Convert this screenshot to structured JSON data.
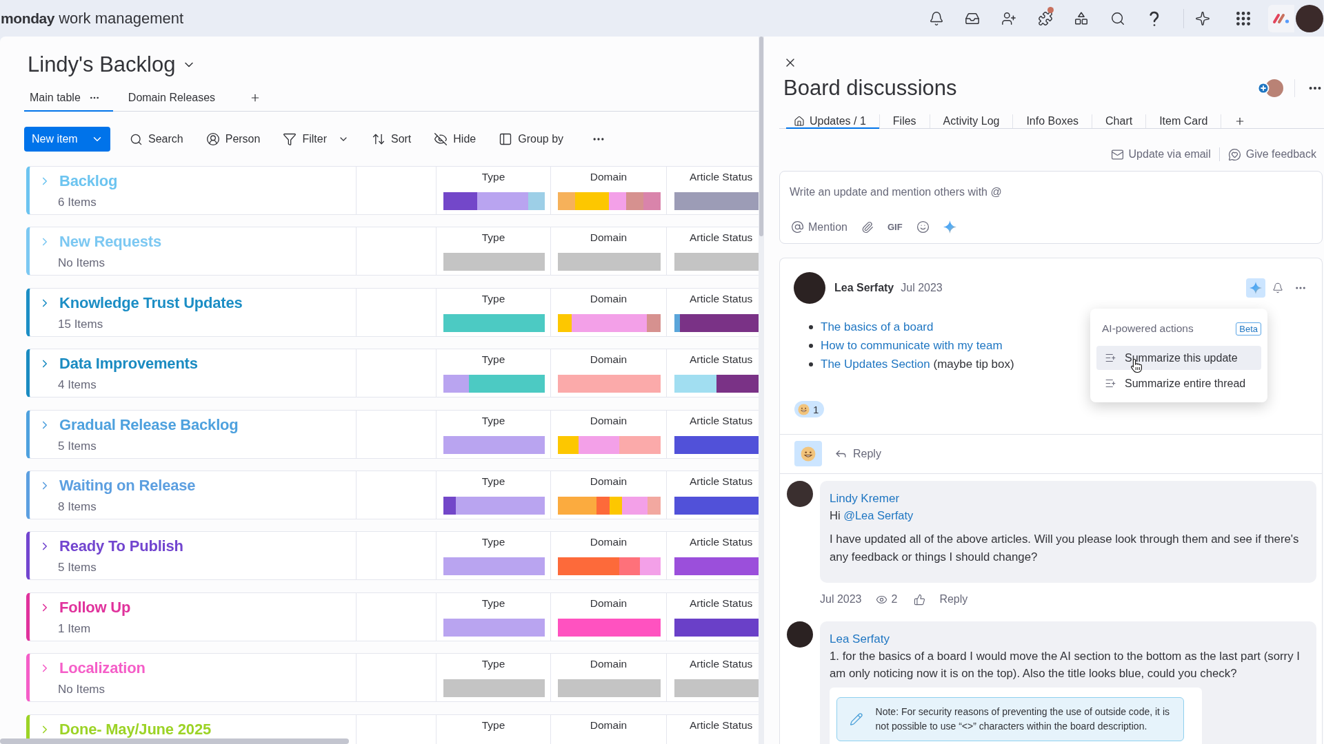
{
  "top_bar": {
    "brand": "monday",
    "product": "work management",
    "apps_notification": true
  },
  "board": {
    "title": "Lindy's Backlog",
    "views": [
      {
        "label": "Main table",
        "selected": true
      },
      {
        "label": "Domain Releases",
        "selected": false
      }
    ]
  },
  "toolbar": {
    "new_item": "New item",
    "actions": [
      {
        "kind": "search",
        "label": "Search",
        "dropdown": false
      },
      {
        "kind": "person",
        "label": "Person",
        "dropdown": false
      },
      {
        "kind": "filter",
        "label": "Filter",
        "dropdown": true
      },
      {
        "kind": "sort",
        "label": "Sort",
        "dropdown": false
      },
      {
        "kind": "hide",
        "label": "Hide",
        "dropdown": false
      },
      {
        "kind": "group",
        "label": "Group by",
        "dropdown": false
      }
    ]
  },
  "groups": [
    {
      "title": "Backlog",
      "count": "6 Items",
      "color": "#6cc4f0",
      "columns": [
        {
          "label": "Type",
          "items": [
            {
              "color": "#7347c9"
            },
            {
              "color": "#7347c9"
            },
            {
              "color": "#b9a4f0"
            },
            {
              "color": "#b9a4f0"
            },
            {
              "color": "#b9a4f0"
            },
            {
              "color": "#9dcfe7"
            }
          ]
        },
        {
          "label": "Domain",
          "items": [
            {
              "color": "#f6b15a"
            },
            {
              "color": "#fdc700"
            },
            {
              "color": "#fdc700"
            },
            {
              "color": "#f3a0e8"
            },
            {
              "color": "#d6918f"
            },
            {
              "color": "#d984ab"
            }
          ]
        },
        {
          "label": "Article Status",
          "items": [
            {
              "color": "#9c9cb6"
            },
            {
              "color": "#9c9cb6"
            },
            {
              "color": "#9c9cb6"
            },
            {
              "color": "#9c9cb6"
            },
            {
              "color": "#9c9cb6"
            },
            {
              "color": "#9c9cb6"
            }
          ]
        }
      ]
    },
    {
      "title": "New Requests",
      "count": "No Items",
      "color": "#7cc8f2",
      "columns": [
        {
          "label": "Type",
          "empty": true
        },
        {
          "label": "Domain",
          "empty": true
        },
        {
          "label": "Article Status",
          "empty": true
        }
      ]
    },
    {
      "title": "Knowledge Trust Updates",
      "count": "15 Items",
      "color": "#1c8ec5",
      "columns": [
        {
          "label": "Type",
          "items": [
            {
              "color": "#4ccac3"
            },
            {
              "color": "#4ccac3"
            },
            {
              "color": "#4ccac3"
            },
            {
              "color": "#4ccac3"
            },
            {
              "color": "#4ccac3"
            },
            {
              "color": "#4ccac3"
            },
            {
              "color": "#4ccac3"
            },
            {
              "color": "#4ccac3"
            },
            {
              "color": "#4ccac3"
            },
            {
              "color": "#4ccac3"
            },
            {
              "color": "#4ccac3"
            },
            {
              "color": "#4ccac3"
            },
            {
              "color": "#4ccac3"
            },
            {
              "color": "#4ccac3"
            },
            {
              "color": "#4ccac3"
            }
          ]
        },
        {
          "label": "Domain",
          "items": [
            {
              "color": "#fdc700"
            },
            {
              "color": "#fdc700"
            },
            {
              "color": "#f3a0e8"
            },
            {
              "color": "#f3a0e8"
            },
            {
              "color": "#f3a0e8"
            },
            {
              "color": "#f3a0e8"
            },
            {
              "color": "#f3a0e8"
            },
            {
              "color": "#f3a0e8"
            },
            {
              "color": "#f3a0e8"
            },
            {
              "color": "#f3a0e8"
            },
            {
              "color": "#f3a0e8"
            },
            {
              "color": "#f3a0e8"
            },
            {
              "color": "#f3a0e8"
            },
            {
              "color": "#d6918f"
            },
            {
              "color": "#d6918f"
            }
          ]
        },
        {
          "label": "Article Status",
          "items": [
            {
              "color": "#5aa5da"
            },
            {
              "color": "#7a3286"
            },
            {
              "color": "#7a3286"
            },
            {
              "color": "#7a3286"
            },
            {
              "color": "#7a3286"
            },
            {
              "color": "#7a3286"
            },
            {
              "color": "#7a3286"
            },
            {
              "color": "#7a3286"
            },
            {
              "color": "#7a3286"
            },
            {
              "color": "#7a3286"
            },
            {
              "color": "#7a3286"
            },
            {
              "color": "#7a3286"
            },
            {
              "color": "#7a3286"
            },
            {
              "color": "#7a3286"
            },
            {
              "color": "#7a3286"
            }
          ]
        }
      ]
    },
    {
      "title": "Data Improvements",
      "count": "4 Items",
      "color": "#1a8bc1",
      "columns": [
        {
          "label": "Type",
          "items": [
            {
              "color": "#b9a4f0"
            },
            {
              "color": "#4ccac3"
            },
            {
              "color": "#4ccac3"
            },
            {
              "color": "#4ccac3"
            }
          ]
        },
        {
          "label": "Domain",
          "items": [
            {
              "color": "#fbaaaa"
            },
            {
              "color": "#fbaaaa"
            },
            {
              "color": "#fbaaaa"
            },
            {
              "color": "#fbaaaa"
            }
          ]
        },
        {
          "label": "Article Status",
          "items": [
            {
              "color": "#a1def1"
            },
            {
              "color": "#a1def1"
            },
            {
              "color": "#7a3286"
            },
            {
              "color": "#7a3286"
            }
          ]
        }
      ]
    },
    {
      "title": "Gradual Release Backlog",
      "count": "5 Items",
      "color": "#4ea1de",
      "columns": [
        {
          "label": "Type",
          "items": [
            {
              "color": "#b9a4f0"
            },
            {
              "color": "#b9a4f0"
            },
            {
              "color": "#b9a4f0"
            },
            {
              "color": "#b9a4f0"
            },
            {
              "color": "#b9a4f0"
            }
          ]
        },
        {
          "label": "Domain",
          "items": [
            {
              "color": "#fdc700"
            },
            {
              "color": "#f3a0e8"
            },
            {
              "color": "#f3a0e8"
            },
            {
              "color": "#fbaaaa"
            },
            {
              "color": "#fbaaaa"
            }
          ]
        },
        {
          "label": "Article Status",
          "items": [
            {
              "color": "#5151d9"
            },
            {
              "color": "#5151d9"
            },
            {
              "color": "#5151d9"
            },
            {
              "color": "#5151d9"
            },
            {
              "color": "#5151d9"
            }
          ]
        }
      ]
    },
    {
      "title": "Waiting on Release",
      "count": "8 Items",
      "color": "#5c9fe0",
      "columns": [
        {
          "label": "Type",
          "items": [
            {
              "color": "#7347c9"
            },
            {
              "color": "#b9a4f0"
            },
            {
              "color": "#b9a4f0"
            },
            {
              "color": "#b9a4f0"
            },
            {
              "color": "#b9a4f0"
            },
            {
              "color": "#b9a4f0"
            },
            {
              "color": "#b9a4f0"
            },
            {
              "color": "#b9a4f0"
            }
          ]
        },
        {
          "label": "Domain",
          "items": [
            {
              "color": "#fbab3f"
            },
            {
              "color": "#fbab3f"
            },
            {
              "color": "#fbab3f"
            },
            {
              "color": "#fd6a3a"
            },
            {
              "color": "#fdc700"
            },
            {
              "color": "#f3a0e8"
            },
            {
              "color": "#f3a0e8"
            },
            {
              "color": "#f2a8a0"
            }
          ]
        },
        {
          "label": "Article Status",
          "items": [
            {
              "color": "#5151d9"
            },
            {
              "color": "#5151d9"
            },
            {
              "color": "#5151d9"
            },
            {
              "color": "#5151d9"
            },
            {
              "color": "#5151d9"
            },
            {
              "color": "#5151d9"
            },
            {
              "color": "#5151d9"
            },
            {
              "color": "#5151d9"
            }
          ]
        }
      ]
    },
    {
      "title": "Ready To Publish",
      "count": "5 Items",
      "color": "#7245cf",
      "columns": [
        {
          "label": "Type",
          "items": [
            {
              "color": "#b9a4f0"
            },
            {
              "color": "#b9a4f0"
            },
            {
              "color": "#b9a4f0"
            },
            {
              "color": "#b9a4f0"
            },
            {
              "color": "#b9a4f0"
            }
          ]
        },
        {
          "label": "Domain",
          "items": [
            {
              "color": "#fd6a3a"
            },
            {
              "color": "#fd6a3a"
            },
            {
              "color": "#fd6a3a"
            },
            {
              "color": "#fe717a"
            },
            {
              "color": "#f3a0e8"
            }
          ]
        },
        {
          "label": "Article Status",
          "items": [
            {
              "color": "#9b4fdb"
            },
            {
              "color": "#9b4fdb"
            },
            {
              "color": "#9b4fdb"
            },
            {
              "color": "#9b4fdb"
            },
            {
              "color": "#9b4fdb"
            }
          ]
        }
      ]
    },
    {
      "title": "Follow Up",
      "count": "1 Item",
      "color": "#e0329c",
      "columns": [
        {
          "label": "Type",
          "items": [
            {
              "color": "#b9a4f0"
            }
          ]
        },
        {
          "label": "Domain",
          "items": [
            {
              "color": "#ff52c0"
            }
          ]
        },
        {
          "label": "Article Status",
          "items": [
            {
              "color": "#6a40c8"
            }
          ]
        }
      ]
    },
    {
      "title": "Localization",
      "count": "No Items",
      "color": "#f55ec8",
      "columns": [
        {
          "label": "Type",
          "empty": true
        },
        {
          "label": "Domain",
          "empty": true
        },
        {
          "label": "Article Status",
          "empty": true
        }
      ]
    },
    {
      "title": "Done- May/June 2025",
      "color": "#9cd326",
      "columns": [
        {
          "label": "Type"
        },
        {
          "label": "Domain"
        },
        {
          "label": "Article Status"
        }
      ]
    }
  ],
  "discussion": {
    "title": "Board discussions",
    "tabs": [
      {
        "label": "Updates / 1",
        "selected": true,
        "home": true
      },
      {
        "label": "Files",
        "selected": false,
        "home": false
      },
      {
        "label": "Activity Log",
        "selected": false,
        "home": false
      },
      {
        "label": "Info Boxes",
        "selected": false,
        "home": false
      },
      {
        "label": "Chart",
        "selected": false,
        "home": false
      },
      {
        "label": "Item Card",
        "selected": false,
        "home": false
      }
    ],
    "links": [
      {
        "kind": "mail",
        "label": "Update via email"
      },
      {
        "kind": "feedback",
        "label": "Give feedback"
      }
    ],
    "composer": {
      "placeholder": "Write an update and mention others with @",
      "mention": "Mention",
      "gif": "GIF"
    },
    "update": {
      "author": "Lea Serfaty",
      "date": "Jul 2023",
      "ai_active": true,
      "items": [
        {
          "link": "The basics of a board"
        },
        {
          "link": "How to communicate with my team"
        },
        {
          "link": "The Updates Section",
          "note": "(maybe tip box)"
        }
      ],
      "reaction_count": "1",
      "reply": "Reply",
      "ai_menu": {
        "title": "AI-powered actions",
        "badge": "Beta",
        "items": [
          {
            "label": "Summarize this update",
            "selected": true
          },
          {
            "label": "Summarize entire thread",
            "selected": false
          }
        ]
      }
    },
    "replies": [
      {
        "author": "Lindy Kremer",
        "greeting": "Hi",
        "mention": "@Lea Serfaty",
        "text": "I have updated all of the above articles. Will you please look through them and see if there's any feedback or things I should change?",
        "date": "Jul 2023",
        "views": "2",
        "action": "Reply"
      },
      {
        "author": "Lea Serfaty",
        "text": "1. for the basics of a board I would move the AI section to the bottom as the last part (sorry I am only noticing now it is on the top). Also the title looks blue, could you check?",
        "note": "Note: For security reasons of preventing the use of outside code, it is not possible to use “<>” characters within the board description."
      }
    ]
  }
}
